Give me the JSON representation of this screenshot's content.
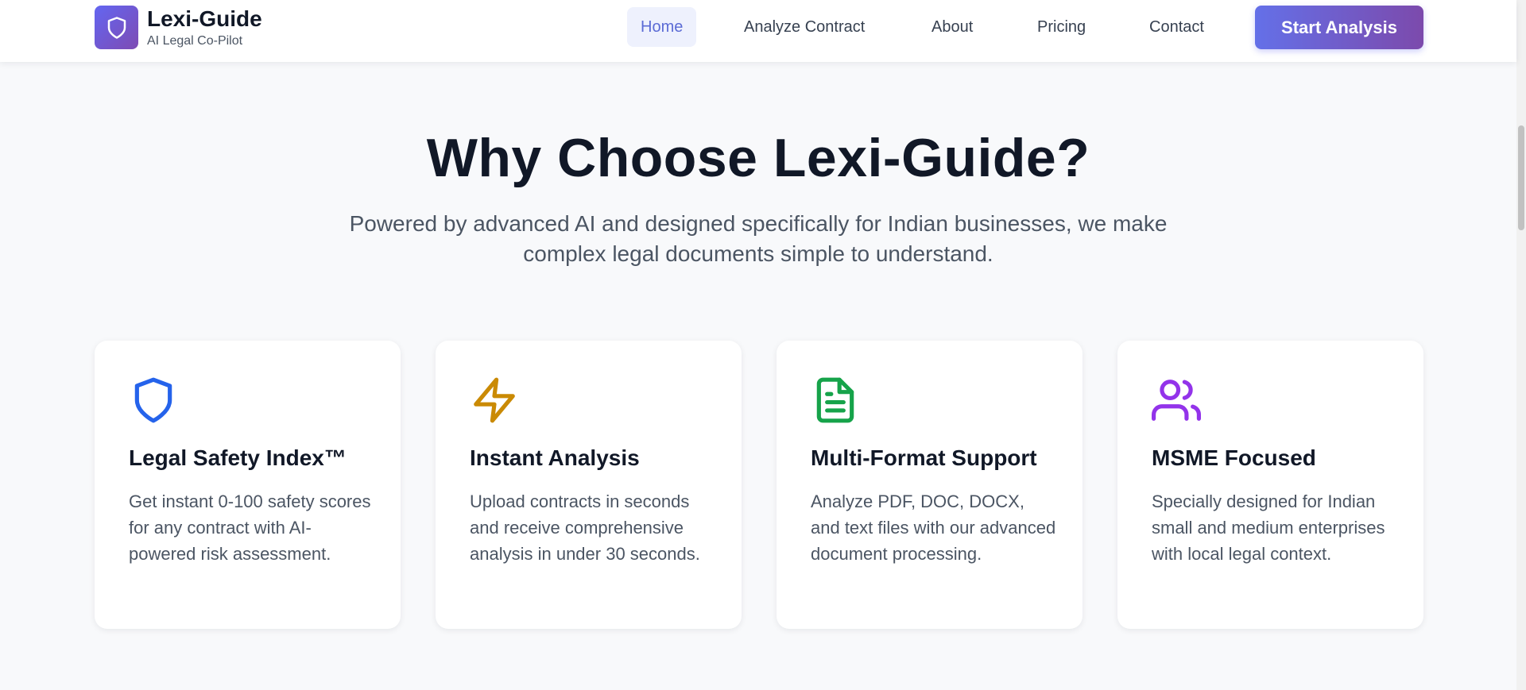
{
  "header": {
    "brand_name": "Lexi-Guide",
    "brand_tagline": "AI Legal Co-Pilot",
    "logo_icon": "shield-icon",
    "nav": [
      {
        "label": "Home",
        "active": true
      },
      {
        "label": "Analyze Contract",
        "active": false
      },
      {
        "label": "About",
        "active": false
      },
      {
        "label": "Pricing",
        "active": false
      },
      {
        "label": "Contact",
        "active": false
      }
    ],
    "cta_label": "Start Analysis"
  },
  "section": {
    "title": "Why Choose Lexi-Guide?",
    "subtitle": "Powered by advanced AI and designed specifically for Indian businesses, we make complex legal documents simple to understand."
  },
  "features": [
    {
      "icon": "shield-icon",
      "icon_color": "#2563eb",
      "title": "Legal Safety Index™",
      "description": "Get instant 0-100 safety scores for any contract with AI-powered risk assessment."
    },
    {
      "icon": "lightning-icon",
      "icon_color": "#ca8a04",
      "title": "Instant Analysis",
      "description": "Upload contracts in seconds and receive comprehensive analysis in under 30 seconds."
    },
    {
      "icon": "document-icon",
      "icon_color": "#16a34a",
      "title": "Multi-Format Support",
      "description": "Analyze PDF, DOC, DOCX, and text files with our advanced document processing."
    },
    {
      "icon": "users-icon",
      "icon_color": "#9333ea",
      "title": "MSME Focused",
      "description": "Specially designed for Indian small and medium enterprises with local legal context."
    }
  ],
  "colors": {
    "brand_gradient_start": "#6366f1",
    "brand_gradient_end": "#7e4bb3",
    "nav_active_bg": "#eef1fd",
    "nav_active_text": "#5b6bd5",
    "page_bg": "#f8f9fb"
  }
}
